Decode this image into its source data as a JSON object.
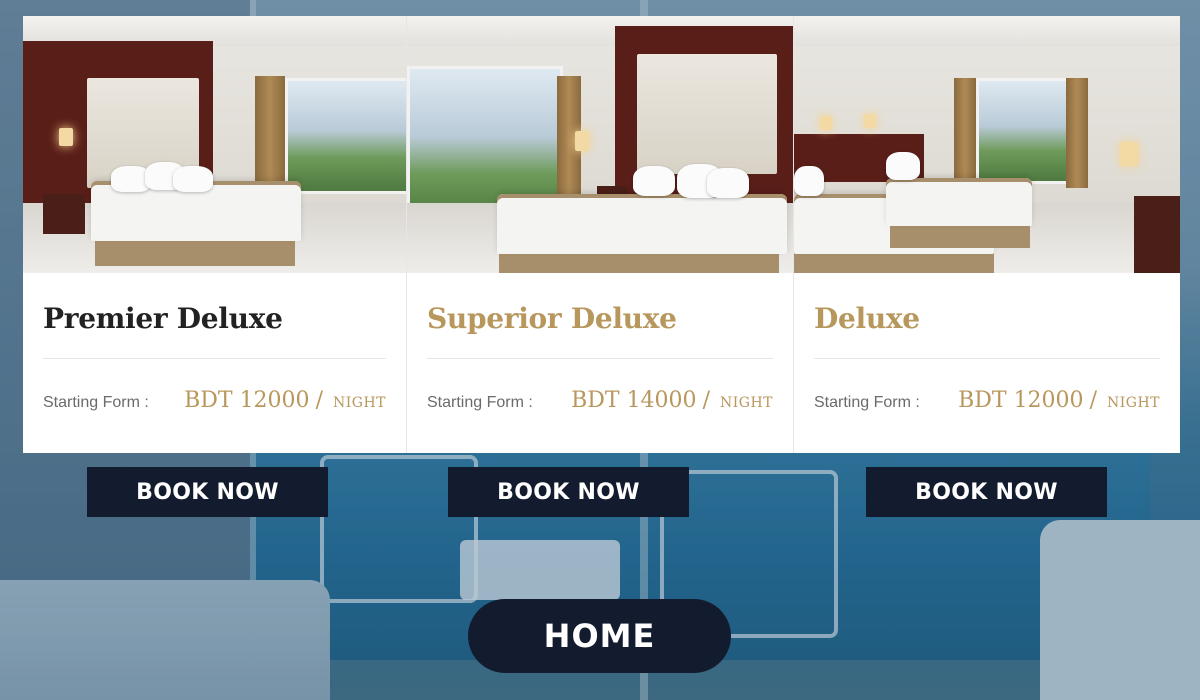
{
  "rooms": [
    {
      "name": "Premier Deluxe",
      "starting_label": "Starting Form :",
      "currency": "BDT",
      "price": "12000",
      "per": "NIGHT",
      "book_label": "BOOK NOW"
    },
    {
      "name": "Superior Deluxe",
      "starting_label": "Starting Form :",
      "currency": "BDT",
      "price": "14000",
      "per": "NIGHT",
      "book_label": "BOOK NOW"
    },
    {
      "name": "Deluxe",
      "starting_label": "Starting Form :",
      "currency": "BDT",
      "price": "12000",
      "per": "NIGHT",
      "book_label": "BOOK NOW"
    }
  ],
  "home_label": "HOME",
  "colors": {
    "accent_gold": "#b8975c",
    "button_navy": "#131c2e",
    "title_dark": "#222222"
  }
}
